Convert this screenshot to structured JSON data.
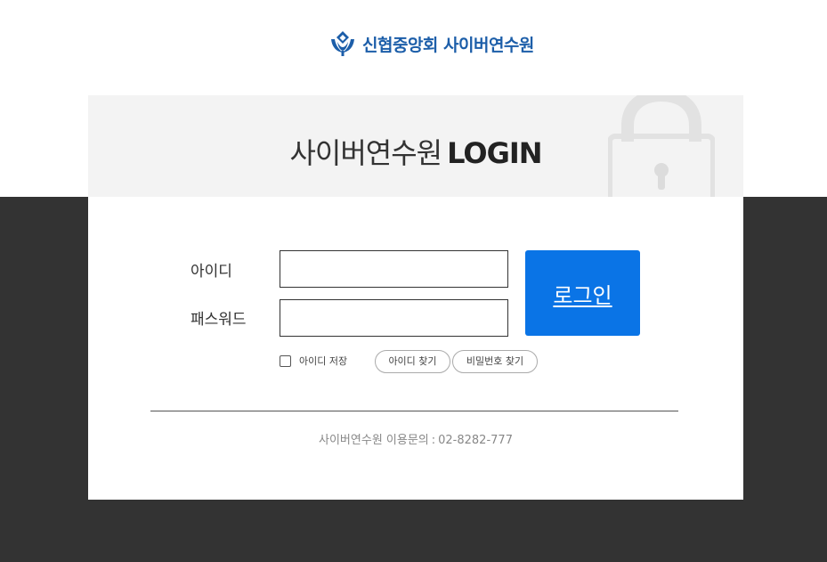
{
  "header": {
    "logo_text": "신협중앙회 사이버연수원",
    "logo_icon": "shinhyup-emblem-icon",
    "brand_color": "#1c5ea9"
  },
  "login_card": {
    "title_korean": "사이버연수원",
    "title_latin": "LOGIN",
    "decor_icon": "padlock-icon",
    "id_label": "아이디",
    "id_value": "",
    "password_label": "패스워드",
    "password_value": "",
    "login_button": "로그인",
    "login_button_color": "#0a74e6",
    "save_id_label": "아이디 저장",
    "save_id_checked": false,
    "find_id_button": "아이디 찾기",
    "find_password_button": "비밀번호 찾기"
  },
  "footer": {
    "contact_label": "사이버연수원 이용문의",
    "contact_separator": ":",
    "contact_phone": "02-8282-777"
  },
  "colors": {
    "page_bottom_background": "#333333",
    "card_header_background": "#f3f3f3"
  }
}
